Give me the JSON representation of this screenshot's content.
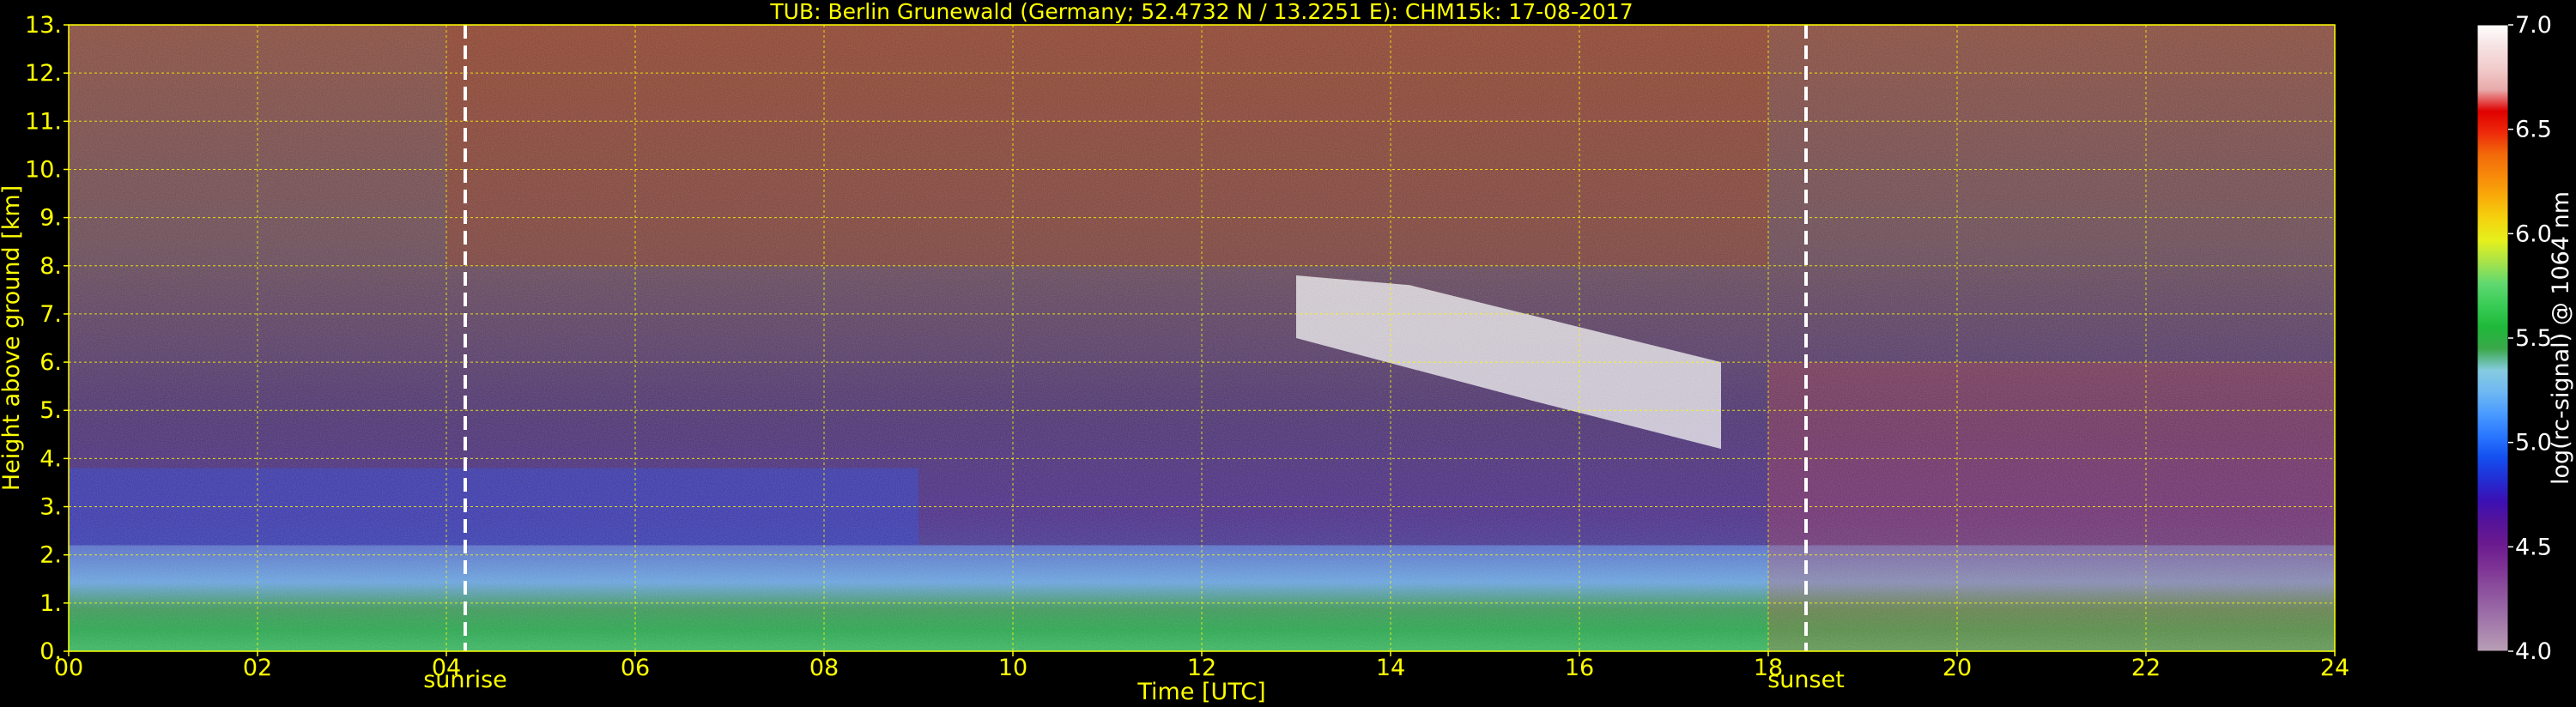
{
  "chart_data": {
    "type": "heatmap",
    "title": "TUB: Berlin Grunewald (Germany; 52.4732 N / 13.2251 E):    CHM15k: 17-08-2017",
    "xlabel": "Time [UTC]",
    "ylabel": "Height above ground [km]",
    "xlim": [
      0,
      24
    ],
    "ylim": [
      0,
      13
    ],
    "x_ticks": [
      "00",
      "02",
      "04",
      "06",
      "08",
      "10",
      "12",
      "14",
      "16",
      "18",
      "20",
      "22",
      "24"
    ],
    "y_ticks": [
      "0.",
      "1.",
      "2.",
      "3.",
      "4.",
      "5.",
      "6.",
      "7.",
      "8.",
      "9.",
      "10.",
      "11.",
      "12.",
      "13."
    ],
    "grid": true,
    "markers": [
      {
        "label": "sunrise",
        "time": 4.2
      },
      {
        "label": "sunset",
        "time": 18.4
      }
    ],
    "colorbar": {
      "label": "log(rc-signal) @ 1064 nm",
      "range": [
        4.0,
        7.0
      ],
      "ticks": [
        "4.0",
        "4.5",
        "5.0",
        "5.5",
        "6.0",
        "6.5",
        "7.0"
      ],
      "colors": [
        "#b89fb5",
        "#a882ad",
        "#9866a5",
        "#8a4c9c",
        "#7c2f94",
        "#6a1a8f",
        "#55139a",
        "#3a10b4",
        "#2030d6",
        "#1450f0",
        "#2a78ff",
        "#4a9bff",
        "#6fb8f2",
        "#86cbe0",
        "#3aa84a",
        "#1fb83a",
        "#38cc55",
        "#5fd870",
        "#a6e34a",
        "#e5f01d",
        "#f4d40e",
        "#f9ad0a",
        "#f88a0a",
        "#f26a0a",
        "#ee2a0a",
        "#e00000",
        "#e8aaaa",
        "#f2cccc",
        "#f6e2e2",
        "#ffffff"
      ]
    },
    "regions": [
      {
        "name": "boundary-layer",
        "t0": 0,
        "t1": 24,
        "h0": 0,
        "h1": 2.2
      },
      {
        "name": "residual-layer",
        "t0": 0,
        "t1": 9,
        "h0": 2.2,
        "h1": 3.8
      },
      {
        "name": "cirrus",
        "t0": 12.2,
        "t1": 17.8,
        "h0": 4.0,
        "h1": 8.0
      },
      {
        "name": "upper-noise",
        "t0": 4,
        "t1": 18,
        "h0": 8,
        "h1": 13
      },
      {
        "name": "evening-clouds",
        "t0": 18,
        "t1": 24,
        "h0": 0,
        "h1": 6
      }
    ]
  }
}
